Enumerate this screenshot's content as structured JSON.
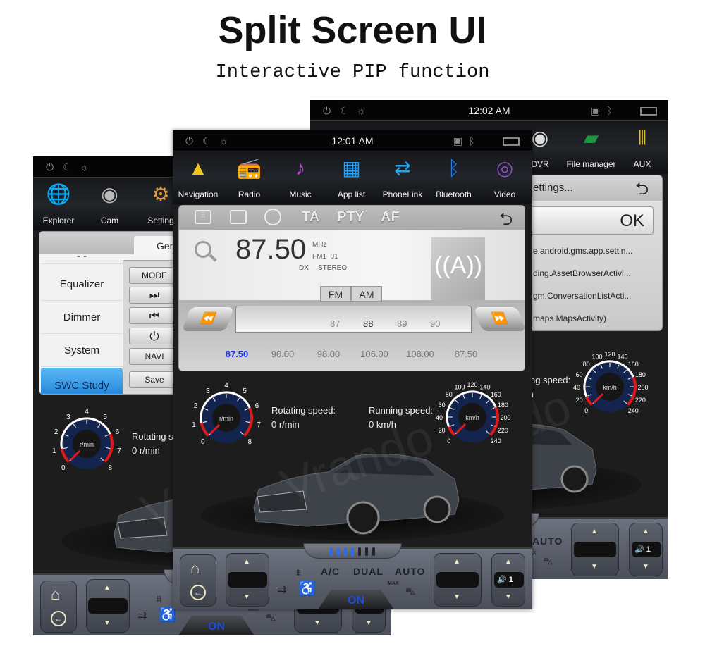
{
  "header": {
    "title": "Split Screen UI",
    "subtitle": "Interactive PIP function"
  },
  "status_icons": [
    "power-icon",
    "night-mode-icon",
    "brightness-icon",
    "usb-icon",
    "bluetooth-icon",
    "multi-window-icon"
  ],
  "screens": {
    "left": {
      "time": "",
      "apps": [
        {
          "label": "Explorer",
          "icon": "globe-icon"
        },
        {
          "label": "Cam",
          "icon": "camera-icon"
        },
        {
          "label": "Setting",
          "icon": "gear-icon"
        }
      ],
      "settings": {
        "tab": "Gen",
        "menu_top": "- -",
        "menu": [
          "Equalizer",
          "Dimmer",
          "System",
          "SWC Study"
        ],
        "active_menu": "SWC Study",
        "buttons": [
          "MODE",
          "⏭",
          "⏮",
          "⏻",
          "NAVI",
          "Save"
        ]
      }
    },
    "middle": {
      "time": "12:01 AM",
      "apps": [
        {
          "label": "Navigation",
          "icon": "navigation-icon"
        },
        {
          "label": "Radio",
          "icon": "radio-icon"
        },
        {
          "label": "Music",
          "icon": "music-icon"
        },
        {
          "label": "App list",
          "icon": "app-list-icon"
        },
        {
          "label": "PhoneLink",
          "icon": "phonelink-icon"
        },
        {
          "label": "Bluetooth",
          "icon": "bluetooth-icon"
        },
        {
          "label": "Video",
          "icon": "video-icon"
        }
      ],
      "radio": {
        "toolbar": [
          "TA",
          "PTY",
          "AF"
        ],
        "frequency": "87.50",
        "unit": "MHz",
        "band_preset": "FM1  01",
        "dx": "DX",
        "stereo": "STEREO",
        "bands": [
          "FM",
          "AM"
        ],
        "scale": [
          "87",
          "88",
          "89",
          "90"
        ],
        "scale_current": "88",
        "presets": [
          "87.50",
          "90.00",
          "98.00",
          "106.00",
          "108.00",
          "87.50"
        ],
        "active_preset_color": "#1a2ee6"
      }
    },
    "right": {
      "time": "12:02 AM",
      "apps": [
        {
          "label": "DVR",
          "icon": "dvr-icon"
        },
        {
          "label": "File manager",
          "icon": "folder-icon"
        },
        {
          "label": "AUX",
          "icon": "aux-icon"
        }
      ],
      "dialog": {
        "title": "ettings...",
        "ok": "OK",
        "items": [
          "e.android.gms.app.settin...",
          "ding.AssetBrowserActivi...",
          "gm.ConversationListActi...",
          "maps.MapsActivity)"
        ]
      }
    }
  },
  "dashboard": {
    "rotating_label": "Rotating speed:",
    "rotating_value": "0 r/min",
    "running_label": "Running speed:",
    "running_value": "0 km/h",
    "rpm_gauge": {
      "unit": "r/min",
      "labels": [
        "0",
        "1",
        "2",
        "3",
        "4",
        "5",
        "6",
        "7",
        "8"
      ],
      "value": 0
    },
    "speed_gauge": {
      "unit": "km/h",
      "labels": [
        "0",
        "20",
        "40",
        "60",
        "80",
        "100",
        "120",
        "140",
        "160",
        "180",
        "200",
        "220",
        "240"
      ],
      "value": 0
    },
    "watermark": "Vrando"
  },
  "climate": {
    "ac": "A/C",
    "dual": "DUAL",
    "auto": "AUTO",
    "on": "ON",
    "max": "MAX",
    "volume": "1",
    "fan_level": 4,
    "fan_max": 7
  }
}
